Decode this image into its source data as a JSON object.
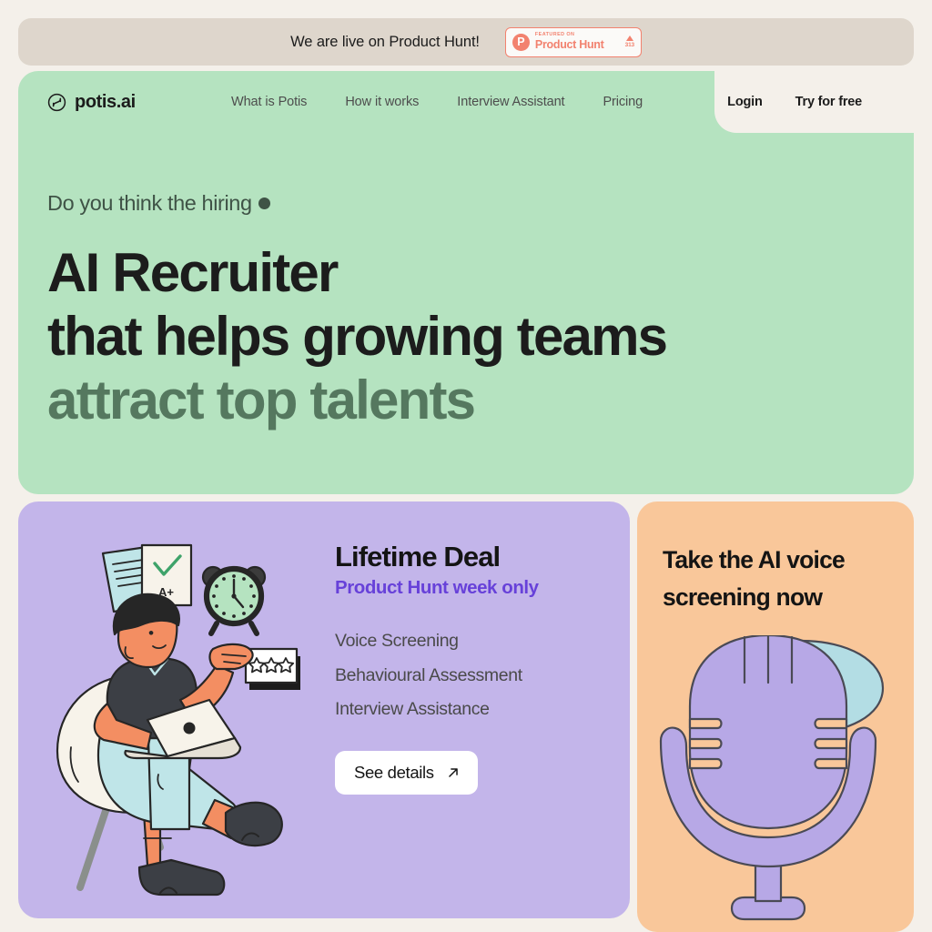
{
  "announcement": {
    "text": "We are live on Product Hunt!",
    "badge": {
      "logo_letter": "P",
      "featured_label": "FEATURED ON",
      "product_name": "Product Hunt",
      "upvote_count": "313",
      "accent_color": "#f2826f"
    }
  },
  "navbar": {
    "brand": "potis.ai",
    "links": [
      {
        "label": "What is Potis"
      },
      {
        "label": "How it works"
      },
      {
        "label": "Interview Assistant"
      },
      {
        "label": "Pricing"
      }
    ],
    "actions": [
      {
        "label": "Login"
      },
      {
        "label": "Try for free"
      }
    ]
  },
  "hero": {
    "eyebrow": "Do you think the hiring",
    "line1": "AI Recruiter",
    "line2": "that helps growing teams",
    "line3": "attract top talents",
    "bg_color": "#b5e3c0"
  },
  "deal_card": {
    "title": "Lifetime Deal",
    "subtitle": "Product Hunt week only",
    "subtitle_color": "#6741d9",
    "features": [
      "Voice Screening",
      "Behavioural Assessment",
      "Interview Assistance"
    ],
    "cta_label": "See details",
    "bg_color": "#c3b5ea",
    "illustration": {
      "grade_label": "A+",
      "star_count": 3
    }
  },
  "voice_card": {
    "title_line1": "Take the AI voice",
    "title_line2": "screening now",
    "bg_color": "#f9c79a"
  }
}
